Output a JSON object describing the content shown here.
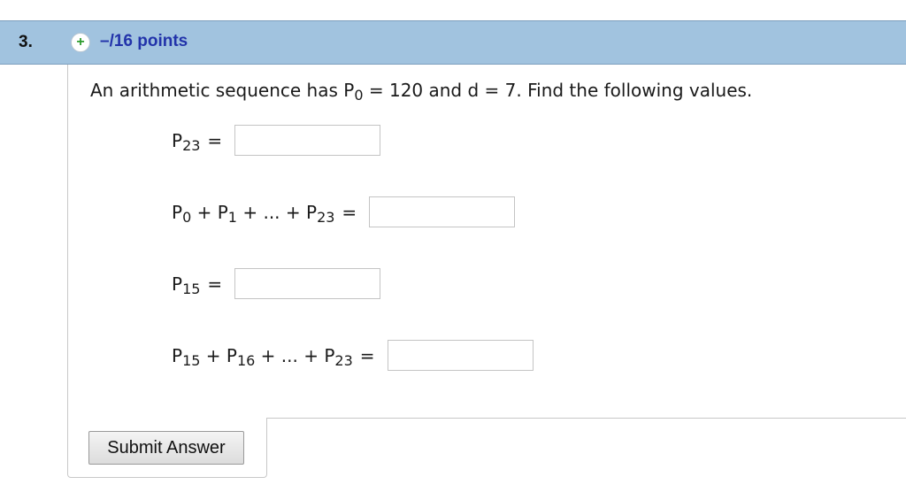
{
  "question": {
    "number": "3.",
    "expand_symbol": "+",
    "points": "–/16 points",
    "prompt": {
      "pre": "An arithmetic sequence has P",
      "sub0": "0",
      "mid": " = 120 and d = 7. Find the following values."
    }
  },
  "rows": [
    {
      "parts": [
        {
          "t": "P"
        },
        {
          "s": "23"
        }
      ],
      "eq": "=",
      "value": ""
    },
    {
      "parts": [
        {
          "t": "P"
        },
        {
          "s": "0"
        },
        {
          "t": " + P"
        },
        {
          "s": "1"
        },
        {
          "t": " + ... + P"
        },
        {
          "s": "23"
        }
      ],
      "eq": "=",
      "value": ""
    },
    {
      "parts": [
        {
          "t": "P"
        },
        {
          "s": "15"
        }
      ],
      "eq": "=",
      "value": ""
    },
    {
      "parts": [
        {
          "t": "P"
        },
        {
          "s": "15"
        },
        {
          "t": " + P"
        },
        {
          "s": "16"
        },
        {
          "t": " + ... + P"
        },
        {
          "s": "23"
        }
      ],
      "eq": "=",
      "value": ""
    }
  ],
  "submit_label": "Submit Answer",
  "colors": {
    "header_bg": "#a1c3df",
    "points_text": "#2233aa",
    "plus_icon": "#2e9b2e"
  }
}
